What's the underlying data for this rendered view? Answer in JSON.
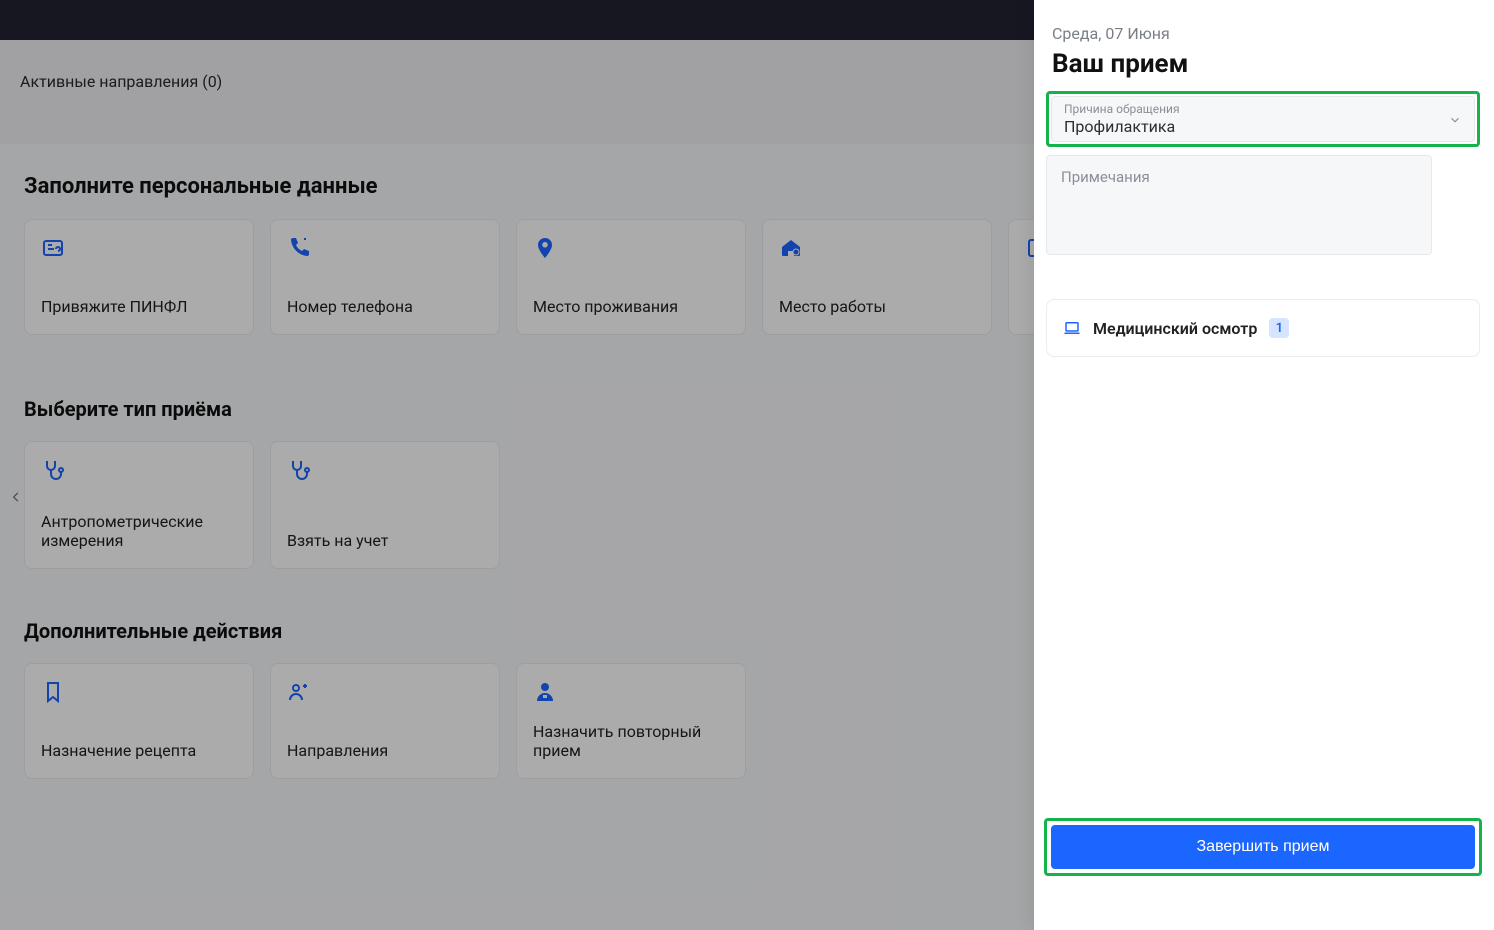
{
  "topbar": {},
  "directions": {
    "label": "Активные направления (0)"
  },
  "sections": {
    "personal": {
      "title": "Заполните персональные данные",
      "cards": [
        {
          "label": "Привяжите ПИНФЛ"
        },
        {
          "label": "Номер телефона"
        },
        {
          "label": "Место проживания"
        },
        {
          "label": "Место работы"
        },
        {
          "label": ""
        }
      ]
    },
    "visit_type": {
      "title": "Выберите тип приёма",
      "cards": [
        {
          "label": "Антропометрические измерения"
        },
        {
          "label": "Взять на учет"
        }
      ]
    },
    "extra": {
      "title": "Дополнительные действия",
      "cards": [
        {
          "label": "Назначение рецепта"
        },
        {
          "label": "Направления"
        },
        {
          "label": "Назначить повторный прием"
        }
      ]
    }
  },
  "sidebar": {
    "date": "Среда, 07 Июня",
    "title": "Ваш прием",
    "reason": {
      "label": "Причина обращения",
      "value": "Профилактика"
    },
    "notes_placeholder": "Примечания",
    "item": {
      "label": "Медицинский осмотр",
      "count": "1"
    },
    "finish_label": "Завершить прием"
  }
}
